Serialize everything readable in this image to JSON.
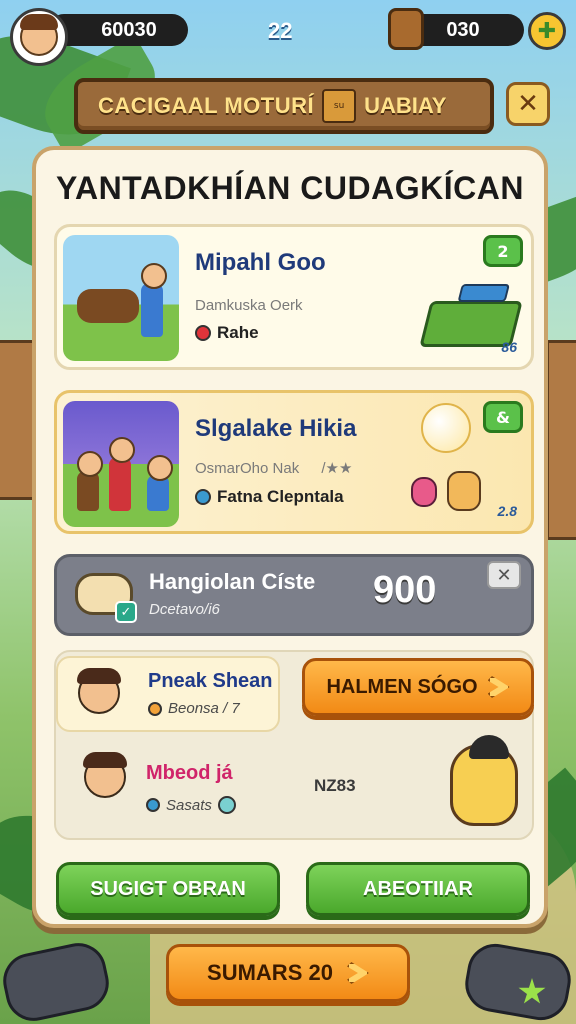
{
  "hud": {
    "coins": "60030",
    "level": "22",
    "gems": "030"
  },
  "banner": {
    "title": "CACIGAAL MOTURÍ",
    "box_label": "su",
    "sub": "UABIAY"
  },
  "panel": {
    "title": "YANTADKHÍAN CUDAGKÍCAN"
  },
  "cards": [
    {
      "title": "Mipahl Goo",
      "sub": "Damkuska Oerk",
      "tag": "Rahe",
      "badge": "2",
      "corner": "86",
      "title_color": "#1f3a7a",
      "accent_color": "#3aa02a",
      "tag_dot_color": "#e0343a"
    },
    {
      "title": "Slgalake Hikia",
      "sub": "OsmarOho Nak",
      "sub_extra": "/★★",
      "tag": "Fatna Clepntala",
      "badge": "&",
      "corner": "2.8",
      "title_color": "#1f3a7a",
      "accent_color": "#3aa02a",
      "tag_dot_color": "#3a9ad0"
    }
  ],
  "challenge": {
    "title": "Hangiolan Císte",
    "sub": "Dcetavo/i6",
    "value": "900",
    "close": "✕"
  },
  "friends": [
    {
      "name": "Pneak Shean",
      "sub": "Beonsa / 7",
      "name_color": "#1f3a8a"
    },
    {
      "name": "Mbeod já",
      "sub": "Sasats",
      "code": "NZ83",
      "name_color": "#d0246a"
    }
  ],
  "buttons": {
    "orange": "HALMEN SÓGO",
    "green_left": "SUGIGT OBRAN",
    "green_right": "ABEOTIIAR",
    "bottom": "SUMARS 20"
  }
}
